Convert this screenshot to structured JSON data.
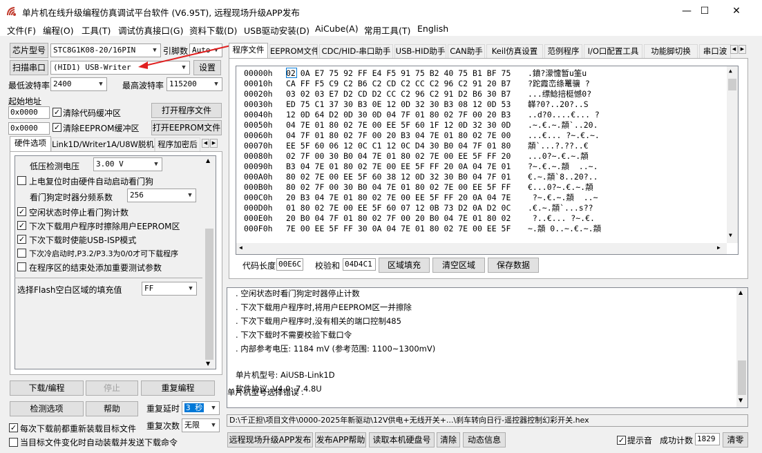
{
  "app": {
    "title": "单片机在线升级编程仿真调试平台软件 (V6.95T), 远程现场升级APP发布"
  },
  "window_buttons": {
    "minimize": "—",
    "maximize": "☐",
    "close": "✕"
  },
  "menu": [
    "文件(F)",
    "编程(O)",
    "工具(T)",
    "调试仿真接口(G)",
    "资料下载(D)",
    "USB驱动安装(D)",
    "AiCube(A)",
    "常用工具(T)",
    "English"
  ],
  "left": {
    "chip_type_btn": "芯片型号",
    "chip_type_value": "STC8G1K08-20/16PIN",
    "pin_label": "引脚数",
    "pin_value": "Auto",
    "scan_port_btn": "扫描串口",
    "port_value": "(HID1) USB-Writer",
    "settings_btn": "设置",
    "min_baud_label": "最低波特率",
    "min_baud_value": "2400",
    "max_baud_label": "最高波特率",
    "max_baud_value": "115200",
    "start_addr_label": "起始地址",
    "code_addr": "0x0000",
    "clear_code_label": "清除代码缓冲区",
    "open_prog_btn": "打开程序文件",
    "eeprom_addr": "0x0000",
    "clear_eeprom_label": "清除EEPROM缓冲区",
    "open_eeprom_btn": "打开EEPROM文件",
    "tabs": [
      "硬件选项",
      "Link1D/Writer1A/U8W脱机",
      "程序加密后"
    ],
    "hw_options": {
      "low_volt_label": "低压检测电压",
      "low_volt_value": "3.00 V",
      "opt1": "上电复位时由硬件自动启动看门狗",
      "wdt_div_label": "看门狗定时器分频系数",
      "wdt_div_value": "256",
      "opt2": "空闲状态时停止看门狗计数",
      "opt3": "下次下载用户程序时擦除用户EEPROM区",
      "opt4": "下次下载时使能USB-ISP模式",
      "opt5": "下次冷启动时,P3.2/P3.3为0/0才可下载程序",
      "opt6": "在程序区的结束处添加重要测试参数",
      "fill_label": "选择Flash空白区域的填充值",
      "fill_value": "FF"
    },
    "download_btn": "下载/编程",
    "stop_btn": "停止",
    "reprogram_btn": "重复编程",
    "check_btn": "检测选项",
    "help_btn": "帮助",
    "repeat_delay_label": "重复延时",
    "repeat_delay_value": "3 秒",
    "repeat_count_label": "重复次数",
    "repeat_count_value": "无限",
    "reload_label": "每次下载前都重新装载目标文件",
    "autosend_label": "当目标文件变化时自动装载并发送下载命令"
  },
  "right": {
    "tabs": [
      "程序文件",
      "EEPROM文件",
      "CDC/HID-串口助手",
      "USB-HID助手",
      "CAN助手",
      "Keil仿真设置",
      "范例程序",
      "I/O口配置工具",
      "功能脚切换",
      "串口波"
    ],
    "hex_rows": [
      {
        "addr": "00000h",
        "bytes": "02 0A E7 75 92 FF E4 F5 91 75 B2 40 75 B1 BF 75",
        "ascii": ".鐼?濛懥暂u筀u"
      },
      {
        "addr": "00010h",
        "bytes": "CA FF F5 C9 C2 B6 C2 CD C2 CC C2 96 C2 91 20 B7",
        "ascii": "?跎霞峦绦鼍骥 ?"
      },
      {
        "addr": "00020h",
        "bytes": "03 02 03 E7 D2 CD D2 CC C2 96 C2 91 D2 B6 30 B7",
        "ascii": "...缥鲶掊梃憾0?"
      },
      {
        "addr": "00030h",
        "bytes": "ED 75 C1 37 30 B3 0E 12 0D 32 30 B3 08 12 0D 53",
        "ascii": "韚?0?..20?..S"
      },
      {
        "addr": "00040h",
        "bytes": "12 0D 64 D2 0D 30 0D 04 7F 01 80 02 7F 00 20 B3",
        "ascii": "..d?0....€... ?"
      },
      {
        "addr": "00050h",
        "bytes": "04 7E 01 80 02 7E 00 EE 5F 60 1F 12 0D 32 30 0D",
        "ascii": ".~.€.~.頮`..20."
      },
      {
        "addr": "00060h",
        "bytes": "04 7F 01 80 02 7F 00 20 B3 04 7E 01 80 02 7E 00",
        "ascii": "...€... ?~.€.~."
      },
      {
        "addr": "00070h",
        "bytes": "EE 5F 60 06 12 0C C1 12 0C D4 30 B0 04 7F 01 80",
        "ascii": "頮`...?.??..€"
      },
      {
        "addr": "00080h",
        "bytes": "02 7F 00 30 B0 04 7E 01 80 02 7E 00 EE 5F FF 20",
        "ascii": "...0?~.€.~.頮 "
      },
      {
        "addr": "00090h",
        "bytes": "B3 04 7E 01 80 02 7E 00 EE 5F FF 20 0A 04 7E 01",
        "ascii": "?~.€.~.頮  ..~."
      },
      {
        "addr": "000A0h",
        "bytes": "80 02 7E 00 EE 5F 60 38 12 0D 32 30 B0 04 7F 01",
        "ascii": "€.~.頮`8..20?.."
      },
      {
        "addr": "000B0h",
        "bytes": "80 02 7F 00 30 B0 04 7E 01 80 02 7E 00 EE 5F FF",
        "ascii": "€...0?~.€.~.頮"
      },
      {
        "addr": "000C0h",
        "bytes": "20 B3 04 7E 01 80 02 7E 00 EE 5F FF 20 0A 04 7E",
        "ascii": " ?~.€.~.頮  ..~"
      },
      {
        "addr": "000D0h",
        "bytes": "01 80 02 7E 00 EE 5F 60 07 12 0B 73 D2 0A D2 0C",
        "ascii": ".€.~.頮`...s??"
      },
      {
        "addr": "000E0h",
        "bytes": "20 B0 04 7F 01 80 02 7F 00 20 B0 04 7E 01 80 02",
        "ascii": " ?..€... ?~.€."
      },
      {
        "addr": "000F0h",
        "bytes": "7E 00 EE 5F FF 30 0A 04 7E 01 80 02 7E 00 EE 5F",
        "ascii": "~.頮 0..~.€.~.頮"
      }
    ],
    "code_len_label": "代码长度",
    "code_len_value": "00E6C",
    "checksum_label": "校验和",
    "checksum_value": "04D4C1",
    "fill_area_btn": "区域填充",
    "clear_area_btn": "清空区域",
    "save_data_btn": "保存数据",
    "log_lines": [
      ". 空闲状态时看门狗定时器停止计数",
      ". 下次下载用户程序时,将用户EEPROM区一并擦除",
      ". 下次下载用户程序时,没有相关的端口控制485",
      ". 下次下载时不需要校验下载口令",
      ". 内部参考电压: 1184 mV (参考范围: 1100~1300mV)",
      "",
      "单片机型号: AiUSB-Link1D",
      "软件协议, V4.0: 7.4.8U",
      "",
      "单片机型号选择错误 ."
    ],
    "file_path": "D:\\千正担\\项目文件\\0000-2025年新驱动\\12V供电+无线开关+...\\刹车转向日行-遥控器控制幻彩开关.hex",
    "remote_upgrade_btn": "远程现场升级APP发布",
    "publish_help_btn": "发布APP帮助",
    "read_disk_btn": "读取本机硬盘号",
    "clear_btn": "清除",
    "dynamic_info_btn": "动态信息",
    "sound_label": "提示音",
    "success_label": "成功计数",
    "success_value": "1829",
    "clear_zero_btn": "清零"
  },
  "colors": {
    "selection": "#0078d7",
    "annotation_arrow": "#e02020"
  }
}
